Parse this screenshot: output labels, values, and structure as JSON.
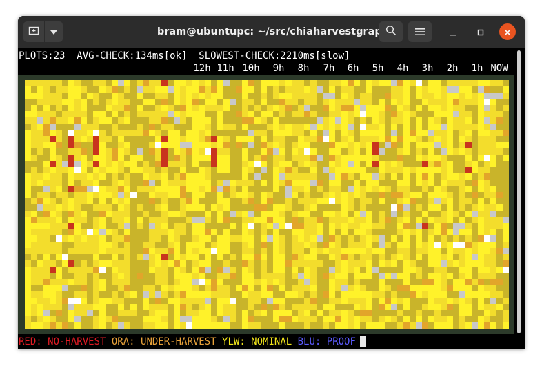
{
  "window": {
    "title": "bram@ubuntupc: ~/src/chiaharvestgraph"
  },
  "icons": {
    "new_tab": "new-tab-icon",
    "dropdown": "chevron-down-icon",
    "search": "search-icon",
    "menu": "hamburger-menu-icon",
    "minimize": "minimize-icon",
    "maximize": "maximize-icon",
    "close": "close-icon"
  },
  "terminal": {
    "status_line": "PLOTS:23  AVG-CHECK:134ms[ok]  SLOWEST-CHECK:2210ms[slow]",
    "hour_labels": [
      "12h",
      "11h",
      "10h",
      "9h",
      "8h",
      "7h",
      "6h",
      "5h",
      "4h",
      "3h",
      "2h",
      "1h",
      "NOW"
    ],
    "legend": [
      {
        "text": "RED: NO-HARVEST",
        "color": "#e01b24"
      },
      {
        "text": "ORA: UNDER-HARVEST",
        "color": "#e8a23a"
      },
      {
        "text": "YLW: NOMINAL",
        "color": "#f2e51a"
      },
      {
        "text": "BLU: PROOF",
        "color": "#5b5bff"
      }
    ]
  },
  "heatmap": {
    "colors": {
      "background": "#2c3a2a",
      "red": "#c8341e",
      "orange": "#e2a52a",
      "yellow_bright": "#fff22a",
      "yellow_mid": "#f3dd2c",
      "yellow_dim": "#c9b42a",
      "white": "#ffffff",
      "gray": "#c8c8c8"
    }
  }
}
